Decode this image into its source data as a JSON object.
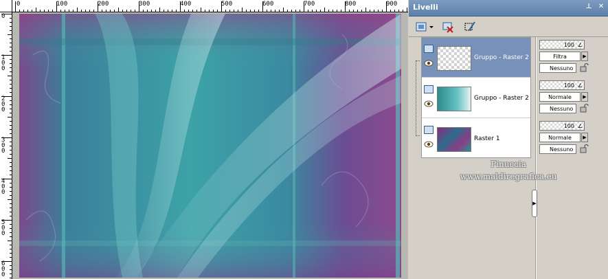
{
  "ruler": {
    "top_labels": [
      "0",
      "100",
      "200",
      "300",
      "400",
      "500",
      "600",
      "700",
      "800",
      "900"
    ],
    "left_labels": [
      "0",
      "100",
      "200",
      "300",
      "400",
      "500",
      "600"
    ]
  },
  "palette": {
    "title": "Livelli",
    "layers": [
      {
        "name": "Gruppo - Raster 2",
        "selected": true,
        "opacity": "100",
        "blend_mode": "Filtra",
        "mask": "Nessuno",
        "thumb": "transparent"
      },
      {
        "name": "Gruppo - Raster 2",
        "selected": false,
        "opacity": "100",
        "blend_mode": "Normale",
        "mask": "Nessuno",
        "thumb": "teal"
      },
      {
        "name": "Raster 1",
        "selected": false,
        "opacity": "100",
        "blend_mode": "Normale",
        "mask": "Nessuno",
        "thumb": "purple"
      }
    ]
  },
  "watermark": {
    "line1": "Pinuccia",
    "line2": "www.maldiregrafica.eu"
  },
  "colors": {
    "selected_row": "#7791b9",
    "teal": "#3a9a9c",
    "purple": "#8a3d84"
  }
}
